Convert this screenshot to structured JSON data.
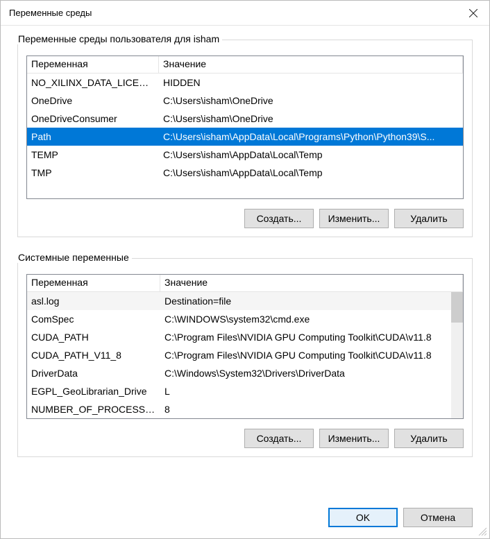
{
  "window": {
    "title": "Переменные среды"
  },
  "userGroup": {
    "legend": "Переменные среды пользователя для isham",
    "headers": {
      "variable": "Переменная",
      "value": "Значение"
    },
    "rows": [
      {
        "name": "NO_XILINX_DATA_LICENSE",
        "value": "HIDDEN"
      },
      {
        "name": "OneDrive",
        "value": "C:\\Users\\isham\\OneDrive"
      },
      {
        "name": "OneDriveConsumer",
        "value": "C:\\Users\\isham\\OneDrive"
      },
      {
        "name": "Path",
        "value": "C:\\Users\\isham\\AppData\\Local\\Programs\\Python\\Python39\\S..."
      },
      {
        "name": "TEMP",
        "value": "C:\\Users\\isham\\AppData\\Local\\Temp"
      },
      {
        "name": "TMP",
        "value": "C:\\Users\\isham\\AppData\\Local\\Temp"
      }
    ],
    "selectedIndex": 3,
    "buttons": {
      "new": "Создать...",
      "edit": "Изменить...",
      "delete": "Удалить"
    }
  },
  "sysGroup": {
    "legend": "Системные переменные",
    "headers": {
      "variable": "Переменная",
      "value": "Значение"
    },
    "rows": [
      {
        "name": "asl.log",
        "value": "Destination=file"
      },
      {
        "name": "ComSpec",
        "value": "C:\\WINDOWS\\system32\\cmd.exe"
      },
      {
        "name": "CUDA_PATH",
        "value": "C:\\Program Files\\NVIDIA GPU Computing Toolkit\\CUDA\\v11.8"
      },
      {
        "name": "CUDA_PATH_V11_8",
        "value": "C:\\Program Files\\NVIDIA GPU Computing Toolkit\\CUDA\\v11.8"
      },
      {
        "name": "DriverData",
        "value": "C:\\Windows\\System32\\Drivers\\DriverData"
      },
      {
        "name": "EGPL_GeoLibrarian_Drive",
        "value": "L"
      },
      {
        "name": "NUMBER_OF_PROCESSORS",
        "value": "8"
      }
    ],
    "buttons": {
      "new": "Создать...",
      "edit": "Изменить...",
      "delete": "Удалить"
    }
  },
  "footer": {
    "ok": "OK",
    "cancel": "Отмена"
  }
}
